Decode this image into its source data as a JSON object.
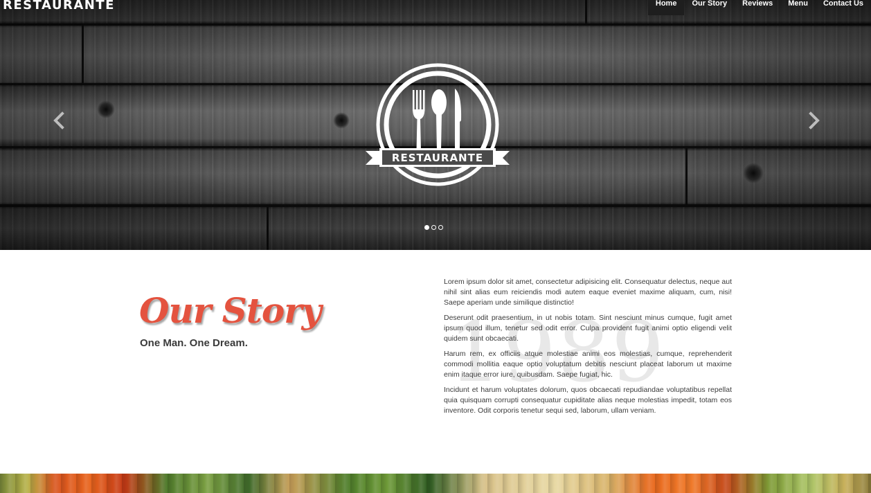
{
  "header": {
    "brand": "RESTAURANTE",
    "nav": [
      "Home",
      "Our Story",
      "Reviews",
      "Menu",
      "Contact Us"
    ],
    "active_nav": "Home"
  },
  "hero": {
    "logo_text": "RESTAURANTE",
    "prev_icon": "chevron-left-icon",
    "next_icon": "chevron-right-icon",
    "slides_total": 3,
    "active_slide": 1
  },
  "story": {
    "title": "Our Story",
    "subtitle": "One Man. One Dream.",
    "year": "1989",
    "paragraphs": [
      "Lorem ipsum dolor sit amet, consectetur adipisicing elit. Consequatur delectus, neque aut nihil sint alias eum reiciendis modi autem eaque eveniet maxime aliquam, cum, nisi! Saepe aperiam unde similique distinctio!",
      "Deserunt odit praesentium, in ut nobis totam. Sint nesciunt minus cumque, fugit amet ipsum quod illum, tenetur sed odit error. Culpa provident fugit animi optio eligendi velit quidem sunt obcaecati.",
      "Harum rem, ex officiis atque molestiae animi eos molestias, cumque, reprehenderit commodi mollitia eaque optio voluptatum debitis nesciunt placeat laborum ut maxime enim itaque error iure, quibusdam. Saepe fugiat, hic.",
      "Incidunt et harum voluptates dolorum, quos obcaecati repudiandae voluptatibus repellat quia quisquam corrupti consequatur cupiditate alias neque molestias impedit, totam eos inventore. Odit corporis tenetur sequi sed, laborum, ullam veniam."
    ]
  },
  "colors": {
    "accent": "#e4533f",
    "hero_dark": "#2b2b2b"
  }
}
